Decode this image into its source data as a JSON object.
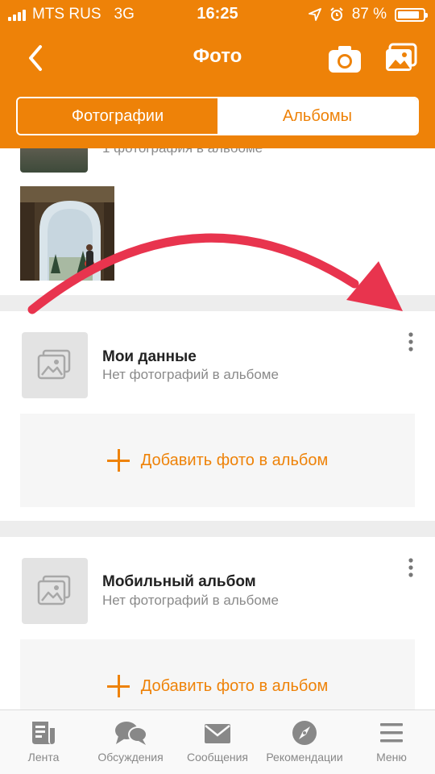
{
  "status_bar": {
    "carrier": "MTS RUS",
    "network": "3G",
    "time": "16:25",
    "battery": "87 %",
    "battery_level": 0.87
  },
  "header": {
    "title": "Фото",
    "icons": [
      "back-chevron-icon",
      "camera-icon",
      "gallery-icon"
    ]
  },
  "segmented": {
    "photos_label": "Фотографии",
    "albums_label": "Альбомы",
    "active": "Фотографии"
  },
  "partial_album": {
    "subtitle": "1 фотография в альбоме"
  },
  "albums": [
    {
      "name": "Мои данные",
      "subtitle": "Нет фотографий в альбоме",
      "add_label": "Добавить фото в альбом"
    },
    {
      "name": "Мобильный альбом",
      "subtitle": "Нет фотографий в альбоме",
      "add_label": "Добавить фото в альбом"
    }
  ],
  "tabs": [
    {
      "label": "Лента",
      "icon": "feed-icon"
    },
    {
      "label": "Обсуждения",
      "icon": "discussions-icon"
    },
    {
      "label": "Сообщения",
      "icon": "envelope-icon"
    },
    {
      "label": "Рекомендации",
      "icon": "compass-icon"
    },
    {
      "label": "Меню",
      "icon": "hamburger-icon"
    }
  ],
  "colors": {
    "accent": "#ee8208",
    "annotation_arrow": "#e8344e",
    "tab_inactive": "#888888"
  }
}
